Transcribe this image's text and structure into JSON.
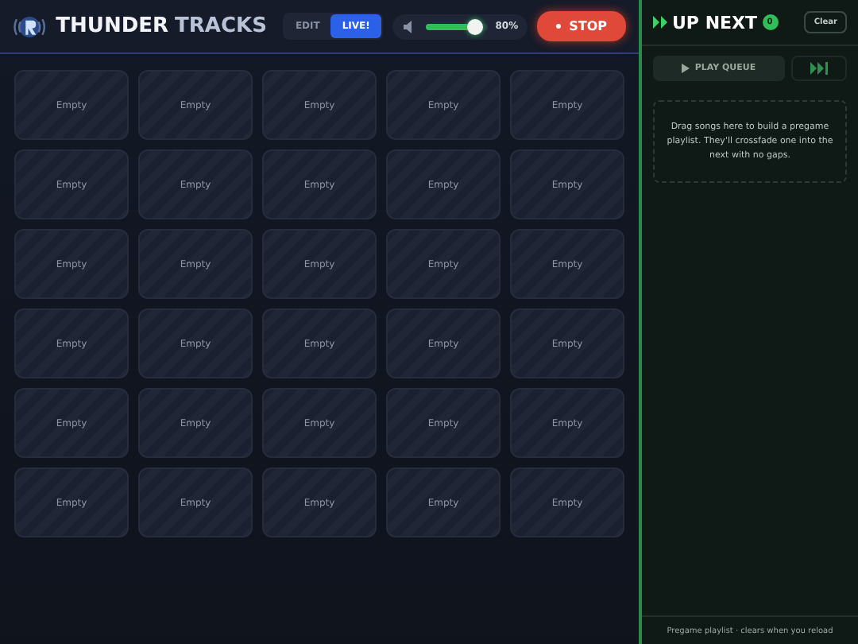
{
  "header": {
    "title_bold": "THUNDER",
    "title_light": "TRACKS",
    "modes": [
      {
        "label": "EDIT",
        "selected": false
      },
      {
        "label": "LIVE!",
        "selected": true
      }
    ],
    "volume": {
      "level": 0.8,
      "reading": "80%"
    },
    "stop_button": "STOP"
  },
  "pads": [
    "Empty",
    "Empty",
    "Empty",
    "Empty",
    "Empty",
    "Empty",
    "Empty",
    "Empty",
    "Empty",
    "Empty",
    "Empty",
    "Empty",
    "Empty",
    "Empty",
    "Empty",
    "Empty",
    "Empty",
    "Empty",
    "Empty",
    "Empty",
    "Empty",
    "Empty",
    "Empty",
    "Empty",
    "Empty",
    "Empty",
    "Empty",
    "Empty",
    "Empty",
    "Empty"
  ],
  "queue": {
    "title": "UP NEXT",
    "count": "0",
    "clear_button": "Clear",
    "play_button": "PLAY QUEUE",
    "empty_text": "Drag songs here to build a pregame playlist. They'll crossfade one into the next with no gaps.",
    "footer": "Pregame playlist · clears when you reload"
  }
}
